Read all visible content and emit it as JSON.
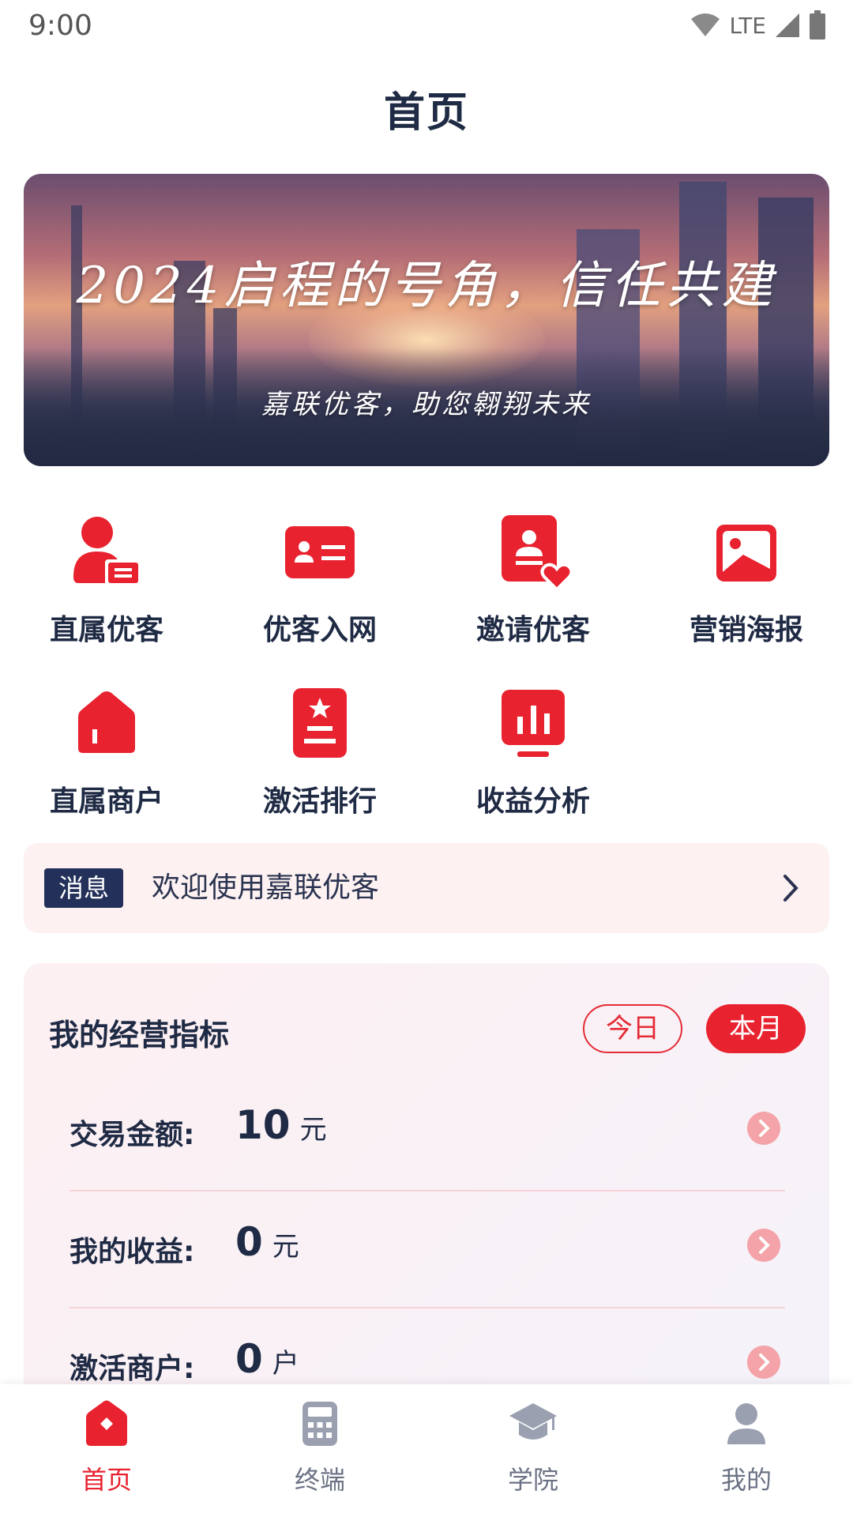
{
  "status_bar": {
    "time": "9:00",
    "network": "LTE"
  },
  "header": {
    "title": "首页"
  },
  "banner": {
    "headline": "2024启程的号角，信任共建",
    "subtitle": "嘉联优客，助您翱翔未来"
  },
  "features": [
    {
      "label": "直属优客",
      "icon": "user-card-icon"
    },
    {
      "label": "优客入网",
      "icon": "id-card-icon"
    },
    {
      "label": "邀请优客",
      "icon": "invite-heart-icon"
    },
    {
      "label": "营销海报",
      "icon": "poster-image-icon"
    },
    {
      "label": "直属商户",
      "icon": "store-house-icon"
    },
    {
      "label": "激活排行",
      "icon": "ranking-star-icon"
    },
    {
      "label": "收益分析",
      "icon": "bar-chart-icon"
    }
  ],
  "message": {
    "badge": "消息",
    "text": "欢迎使用嘉联优客"
  },
  "metrics": {
    "title": "我的经营指标",
    "filters": {
      "today": "今日",
      "month": "本月",
      "selected": "本月"
    },
    "rows": [
      {
        "label": "交易金额:",
        "value": "10",
        "unit": "元"
      },
      {
        "label": "我的收益:",
        "value": "0",
        "unit": "元"
      },
      {
        "label": "激活商户:",
        "value": "0",
        "unit": "户"
      }
    ]
  },
  "bottom_nav": [
    {
      "label": "首页",
      "icon": "home-icon",
      "active": true
    },
    {
      "label": "终端",
      "icon": "calculator-icon",
      "active": false
    },
    {
      "label": "学院",
      "icon": "graduation-cap-icon",
      "active": false
    },
    {
      "label": "我的",
      "icon": "person-icon",
      "active": false
    }
  ],
  "colors": {
    "accent": "#e8222f",
    "text": "#1f2a44",
    "badge_bg": "#22305a"
  }
}
